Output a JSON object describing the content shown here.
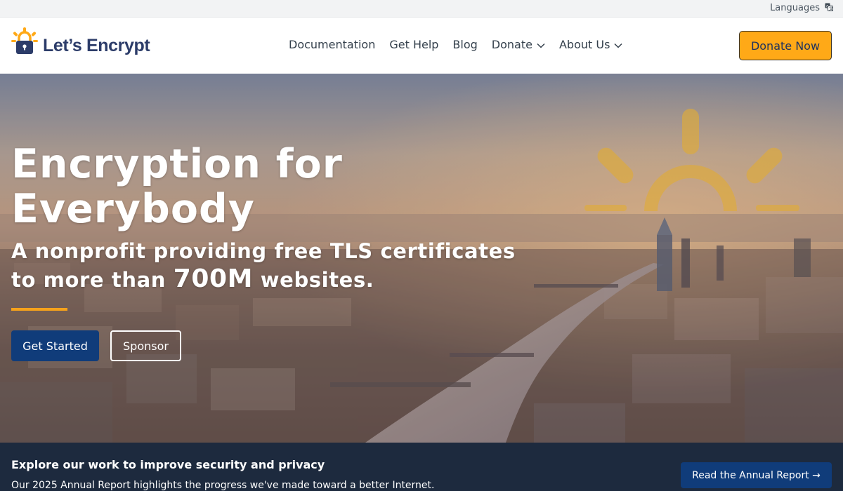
{
  "top_bar": {
    "languages_label": "Languages",
    "languages_icon": "translate-icon"
  },
  "header": {
    "logo_text": "Let’s Encrypt",
    "logo_icon": "padlock-sun-icon",
    "nav": [
      {
        "label": "Documentation",
        "has_dropdown": false
      },
      {
        "label": "Get Help",
        "has_dropdown": false
      },
      {
        "label": "Blog",
        "has_dropdown": false
      },
      {
        "label": "Donate",
        "has_dropdown": true
      },
      {
        "label": "About Us",
        "has_dropdown": true
      }
    ],
    "cta_label": "Donate Now"
  },
  "hero": {
    "title": "Encryption for Everybody",
    "subtitle_before": "A nonprofit providing free TLS certificates to more than ",
    "subtitle_highlight": "700M",
    "subtitle_after": " websites.",
    "primary_button": "Get Started",
    "secondary_button": "Sponsor",
    "background_description_icon": "city-skyline-sunrise"
  },
  "banner": {
    "title": "Explore our work to improve security and privacy",
    "text": "Our 2025 Annual Report highlights the progress we've made toward a better Internet.",
    "button_label": "Read the Annual Report →"
  },
  "colors": {
    "brand_navy": "#2c3c69",
    "brand_orange": "#ffa917",
    "button_blue": "#103c7a",
    "banner_bg": "#1d2a3e",
    "accent_rule": "#f5a21b"
  }
}
